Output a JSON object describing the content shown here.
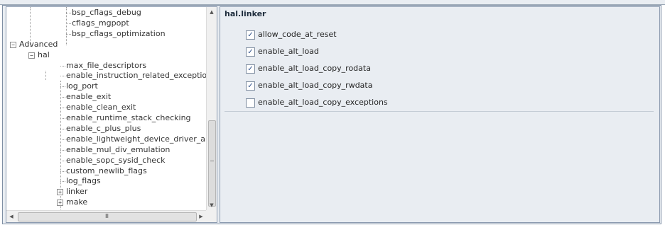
{
  "tree": {
    "items": [
      {
        "label": "bsp_cflags_debug",
        "depth": 3
      },
      {
        "label": "cflags_mgpopt",
        "depth": 3
      },
      {
        "label": "bsp_cflags_optimization",
        "depth": 3
      },
      {
        "label": "Advanced",
        "depth": 0,
        "expander": "-"
      },
      {
        "label": "hal",
        "depth": 1,
        "expander": "-"
      },
      {
        "label": "max_file_descriptors",
        "depth": 2
      },
      {
        "label": "enable_instruction_related_exceptions",
        "depth": 2
      },
      {
        "label": "log_port",
        "depth": 2
      },
      {
        "label": "enable_exit",
        "depth": 2
      },
      {
        "label": "enable_clean_exit",
        "depth": 2
      },
      {
        "label": "enable_runtime_stack_checking",
        "depth": 2
      },
      {
        "label": "enable_c_plus_plus",
        "depth": 2
      },
      {
        "label": "enable_lightweight_device_driver_api",
        "depth": 2
      },
      {
        "label": "enable_mul_div_emulation",
        "depth": 2
      },
      {
        "label": "enable_sopc_sysid_check",
        "depth": 2
      },
      {
        "label": "custom_newlib_flags",
        "depth": 2
      },
      {
        "label": "log_flags",
        "depth": 2
      },
      {
        "label": "linker",
        "depth": 2,
        "expander": "+"
      },
      {
        "label": "make",
        "depth": 2,
        "expander": "+"
      }
    ],
    "hscroll_grip": "III"
  },
  "panel": {
    "title": "hal.linker",
    "options": [
      {
        "label": "allow_code_at_reset",
        "checked": true
      },
      {
        "label": "enable_alt_load",
        "checked": true
      },
      {
        "label": "enable_alt_load_copy_rodata",
        "checked": true
      },
      {
        "label": "enable_alt_load_copy_rwdata",
        "checked": true
      },
      {
        "label": "enable_alt_load_copy_exceptions",
        "checked": false
      }
    ]
  }
}
